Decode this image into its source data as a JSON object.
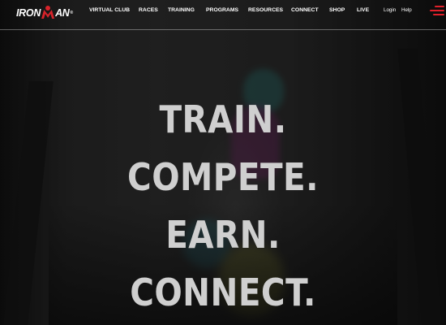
{
  "brand": {
    "logo_left": "IRON",
    "logo_right": "AN",
    "logo_mark": "ironman-m-dot",
    "trademark": "®",
    "accent_color": "#d8232a"
  },
  "nav": {
    "items": [
      {
        "label": "VIRTUAL CLUB"
      },
      {
        "label": "RACES"
      },
      {
        "label": "TRAINING"
      },
      {
        "label": "PROGRAMS"
      },
      {
        "label": "RESOURCES"
      },
      {
        "label": "CONNECT"
      },
      {
        "label": "SHOP"
      },
      {
        "label": "LIVE"
      }
    ],
    "login": "Login",
    "help": "Help",
    "menu_icon": "hamburger-menu-icon"
  },
  "hero": {
    "lines": [
      "TRAIN.",
      "COMPETE.",
      "EARN.",
      "CONNECT."
    ],
    "text_color": "#cfcfcf"
  }
}
